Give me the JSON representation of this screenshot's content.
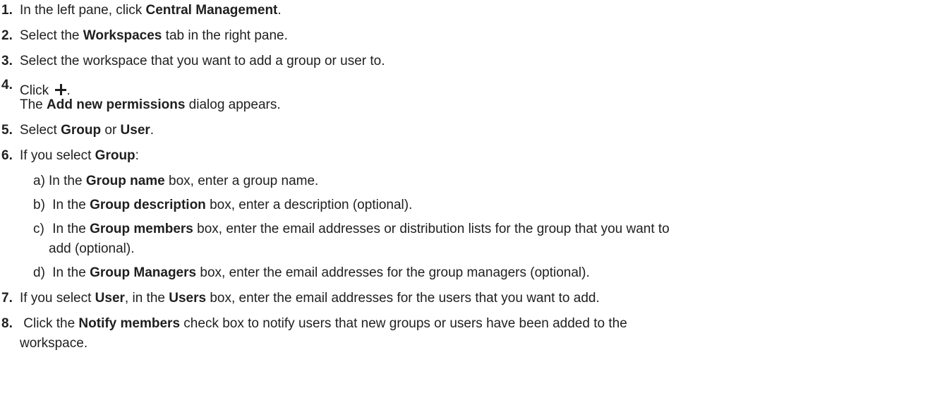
{
  "steps": [
    {
      "n": "1.",
      "pre": "In the left pane, click ",
      "b1": "Central Management",
      "post": "."
    },
    {
      "n": "2.",
      "pre": "Select the ",
      "b1": "Workspaces",
      "post": " tab in the right pane."
    },
    {
      "n": "3.",
      "text": "Select the workspace that you want to add a group or user to."
    },
    {
      "n": "4.",
      "pre": "Click ",
      "post": ".",
      "line2_pre": "The ",
      "line2_b": "Add new permissions",
      "line2_post": " dialog appears."
    },
    {
      "n": "5.",
      "pre": "Select ",
      "b1": "Group",
      "mid": " or ",
      "b2": "User",
      "post": "."
    },
    {
      "n": "6.",
      "pre": "If you select ",
      "b1": "Group",
      "post": ":"
    },
    {
      "n": "7.",
      "pre": "If you select ",
      "b1": "User",
      "mid": ", in the ",
      "b2": "Users",
      "post": " box, enter the email addresses for the users that you want to add."
    },
    {
      "n": "8.",
      "pre": " Click the ",
      "b1": "Notify members",
      "post": " check box to notify users that new groups or users have been added to the",
      "line2": "workspace."
    }
  ],
  "substeps": [
    {
      "l": "a)",
      "pre": "In the ",
      "b": "Group name",
      "post": " box, enter a group name."
    },
    {
      "l": "b)",
      "pre": " In the ",
      "b": "Group description",
      "post": " box, enter a description (optional)."
    },
    {
      "l": "c)",
      "pre": " In the ",
      "b": "Group members",
      "post": " box, enter the email addresses or distribution lists for the group that you want to",
      "line2": "add (optional)."
    },
    {
      "l": "d)",
      "pre": " In the ",
      "b": "Group Managers",
      "post": " box, enter the email addresses for the group managers (optional)."
    }
  ]
}
